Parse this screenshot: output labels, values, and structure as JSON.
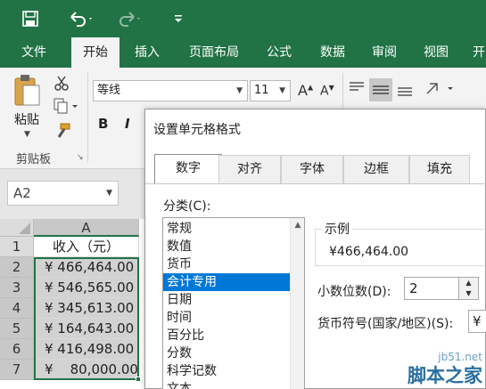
{
  "ribbon_tabs": [
    "文件",
    "开始",
    "插入",
    "页面布局",
    "公式",
    "数据",
    "审阅",
    "视图",
    "开"
  ],
  "active_tab": "开始",
  "clipboard": {
    "paste_label": "粘贴",
    "group_label": "剪贴板"
  },
  "font": {
    "name": "等线",
    "size": "11",
    "bold": "B",
    "italic": "I"
  },
  "name_box": "A2",
  "sheet": {
    "column_header": "A",
    "row_headers": [
      "1",
      "2",
      "3",
      "4",
      "5",
      "6",
      "7"
    ],
    "header_cell": "收入（元）",
    "cells": [
      "¥ 466,464.00",
      "¥ 546,565.00",
      "¥ 345,613.00",
      "¥ 164,643.00",
      "¥ 416,498.00",
      "¥    80,000.00"
    ]
  },
  "dialog": {
    "title": "设置单元格格式",
    "tabs": [
      "数字",
      "对齐",
      "字体",
      "边框",
      "填充"
    ],
    "active_tab": "数字",
    "category_label": "分类(C):",
    "categories": [
      "常规",
      "数值",
      "货币",
      "会计专用",
      "日期",
      "时间",
      "百分比",
      "分数",
      "科学记数",
      "文本"
    ],
    "selected_category": "会计专用",
    "sample_label": "示例",
    "sample_value": "¥466,464.00",
    "decimal_label": "小数位数(D):",
    "decimal_value": "2",
    "currency_label": "货币符号(国家/地区)(S):",
    "currency_value": "¥"
  },
  "watermark": {
    "small": "jb51.net",
    "big": "脚本之家"
  },
  "colors": {
    "excel_green": "#217346",
    "selection_blue": "#0078d7",
    "selected_cell_gray": "#d2d2d2",
    "selection_border": "#217346"
  }
}
